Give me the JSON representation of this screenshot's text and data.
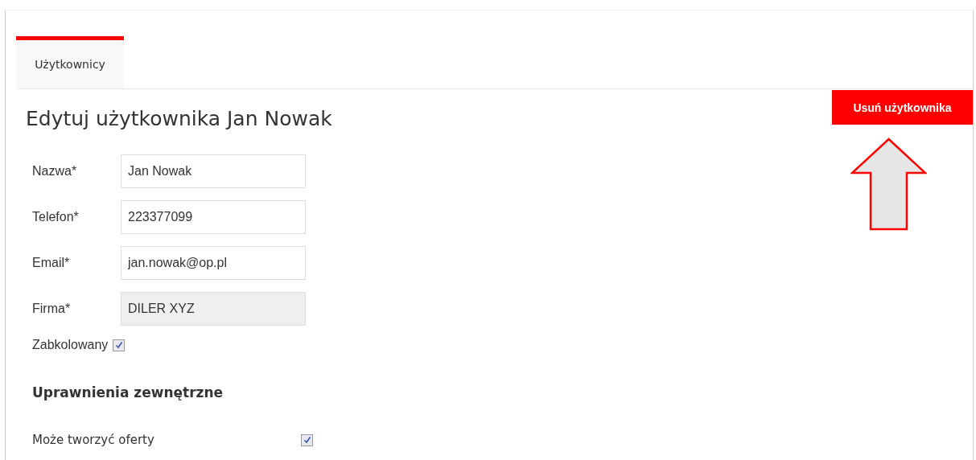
{
  "tabs": [
    {
      "label": "Użytkownicy",
      "selected": true
    }
  ],
  "delete_button": "Usuń użytkownika",
  "title": "Edytuj użytkownika Jan Nowak",
  "fields": [
    {
      "label": "Nazwa*",
      "value": "Jan Nowak",
      "disabled": false
    },
    {
      "label": "Telefon*",
      "value": "223377099",
      "disabled": false
    },
    {
      "label": "Email*",
      "value": "jan.nowak@op.pl",
      "disabled": false
    },
    {
      "label": "Firma*",
      "value": "DILER XYZ",
      "disabled": true
    }
  ],
  "blocked": {
    "label": "Zabkolowany",
    "checked": true
  },
  "permissions_heading": "Uprawnienia zewnętrzne",
  "permissions": [
    {
      "label": "Może tworzyć oferty",
      "checked": true
    }
  ]
}
